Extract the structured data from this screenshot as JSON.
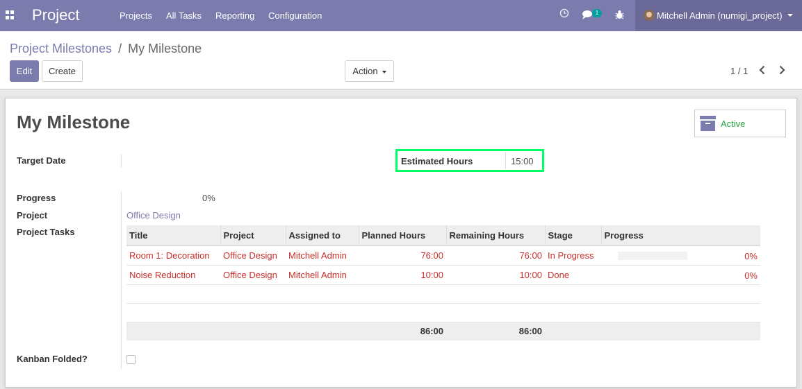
{
  "navbar": {
    "brand": "Project",
    "menu": [
      "Projects",
      "All Tasks",
      "Reporting",
      "Configuration"
    ],
    "messages_count": "1",
    "user": "Mitchell Admin (numigi_project)",
    "icons": [
      "apps-icon",
      "clock-icon",
      "chat-icon",
      "bug-icon"
    ]
  },
  "breadcrumb": {
    "parent": "Project Milestones",
    "separator": "/",
    "current": "My Milestone"
  },
  "buttons": {
    "edit": "Edit",
    "create": "Create",
    "action": "Action"
  },
  "pager": {
    "value": "1 / 1"
  },
  "form": {
    "title": "My Milestone",
    "active_label": "Active",
    "target_date_label": "Target Date",
    "target_date_value": "",
    "estimated_hours_label": "Estimated Hours",
    "estimated_hours_value": "15:00",
    "progress_label": "Progress",
    "progress_value": "0%",
    "project_label": "Project",
    "project_value": "Office Design",
    "project_tasks_label": "Project Tasks",
    "kanban_folded_label": "Kanban Folded?",
    "kanban_folded_value": false
  },
  "tasks": {
    "columns": [
      "Title",
      "Project",
      "Assigned to",
      "Planned Hours",
      "Remaining Hours",
      "Stage",
      "Progress"
    ],
    "rows": [
      {
        "title": "Room 1: Decoration",
        "project": "Office Design",
        "assigned_to": "Mitchell Admin",
        "planned_hours": "76:00",
        "remaining_hours": "76:00",
        "stage": "In Progress",
        "progress": "0%"
      },
      {
        "title": "Noise Reduction",
        "project": "Office Design",
        "assigned_to": "Mitchell Admin",
        "planned_hours": "10:00",
        "remaining_hours": "10:00",
        "stage": "Done",
        "progress": "0%"
      }
    ],
    "totals": {
      "planned_hours": "86:00",
      "remaining_hours": "86:00"
    }
  },
  "colors": {
    "navbar": "#7c7bad",
    "primary": "#7c7bad",
    "highlight": "#00ff66",
    "active_text": "#28a745",
    "task_text": "#c9302c"
  }
}
